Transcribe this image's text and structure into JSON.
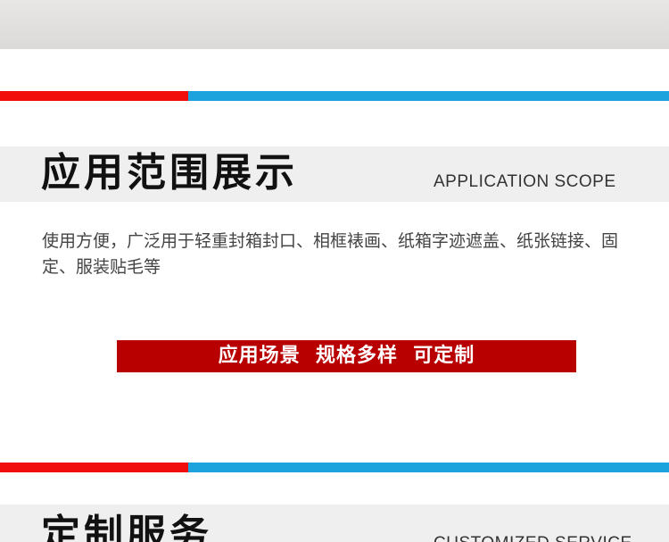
{
  "section1": {
    "title_cn": "应用范围展示",
    "title_en": "APPLICATION SCOPE",
    "description": "使用方便，广泛用于轻重封箱封口、相框裱画、纸箱字迹遮盖、纸张链接、固定、服装贴毛等",
    "banner_text": "应用场景  规格多样  可定制"
  },
  "section2": {
    "title_cn": "定制服务",
    "title_en": "CUSTOMIZED SERVICE"
  },
  "colors": {
    "stripe_red": "#f20d0d",
    "stripe_blue": "#1ca3de",
    "banner_red": "#b80000",
    "heading_band": "#efefef"
  }
}
